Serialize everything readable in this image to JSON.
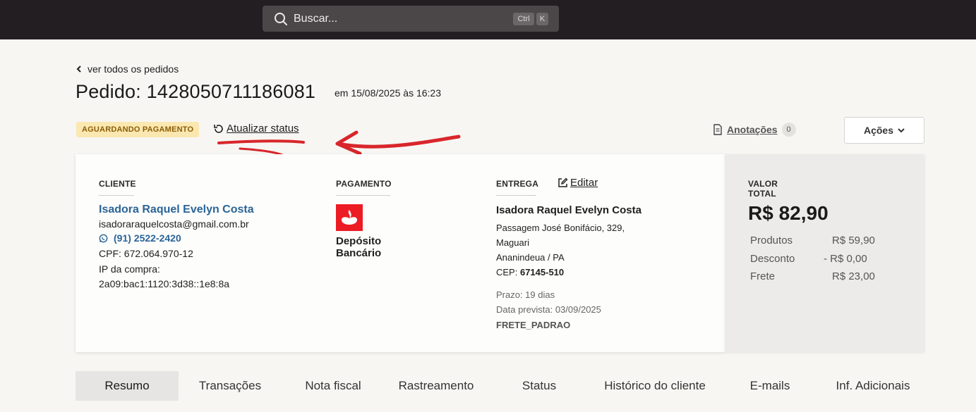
{
  "search": {
    "placeholder": "Buscar...",
    "shortcut_ctrl": "Ctrl",
    "shortcut_key": "K"
  },
  "nav": {
    "back_label": "ver todos os pedidos"
  },
  "order": {
    "title": "Pedido: 1428050711186081",
    "date": "em 15/08/2025 às 16:23",
    "status_badge": "AGUARDANDO PAGAMENTO",
    "refresh_label": "Atualizar status"
  },
  "toolbar": {
    "notes_label": "Anotações",
    "notes_count": "0",
    "actions_label": "Ações"
  },
  "client": {
    "heading": "CLIENTE",
    "name": "Isadora Raquel Evelyn Costa",
    "email": "isadoraraquelcosta@gmail.com.br",
    "phone": "(91) 2522-2420",
    "cpf": "CPF: 672.064.970-12",
    "ip_label": "IP da compra:",
    "ip": "2a09:bac1:1120:3d38::1e8:8a"
  },
  "payment": {
    "heading": "PAGAMENTO",
    "method_line1": "Depósito",
    "method_line2": "Bancário"
  },
  "delivery": {
    "heading": "ENTREGA",
    "edit_label": "Editar",
    "name": "Isadora Raquel Evelyn Costa",
    "address1": "Passagem José Bonifácio, 329,",
    "address2": "Maguari",
    "city": "Ananindeua / PA",
    "cep_label": "CEP:",
    "cep": "67145-510",
    "prazo": "Prazo: 19 dias",
    "data_prevista": "Data prevista: 03/09/2025",
    "frete_tipo": "FRETE_PADRAO"
  },
  "total": {
    "heading": "VALOR TOTAL",
    "value": "R$ 82,90",
    "rows": [
      {
        "label": "Produtos",
        "value": "R$ 59,90"
      },
      {
        "label": "Desconto",
        "value": "- R$ 0,00"
      },
      {
        "label": "Frete",
        "value": "R$ 23,00"
      }
    ]
  },
  "tabs": [
    "Resumo",
    "Transações",
    "Nota fiscal",
    "Rastreamento",
    "Status",
    "Histórico do cliente",
    "E-mails",
    "Inf. Adicionais"
  ],
  "colors": {
    "topbar": "#221e21",
    "link_blue": "#2a6496",
    "badge_bg": "#fbe8b0",
    "badge_text": "#8a5d08",
    "annotation_red": "#d8262b",
    "santander_red": "#ec1c24"
  },
  "icons": [
    "search-icon",
    "chevron-left-icon",
    "refresh-icon",
    "document-icon",
    "chevron-down-icon",
    "whatsapp-icon",
    "santander-flame-icon",
    "edit-icon"
  ]
}
